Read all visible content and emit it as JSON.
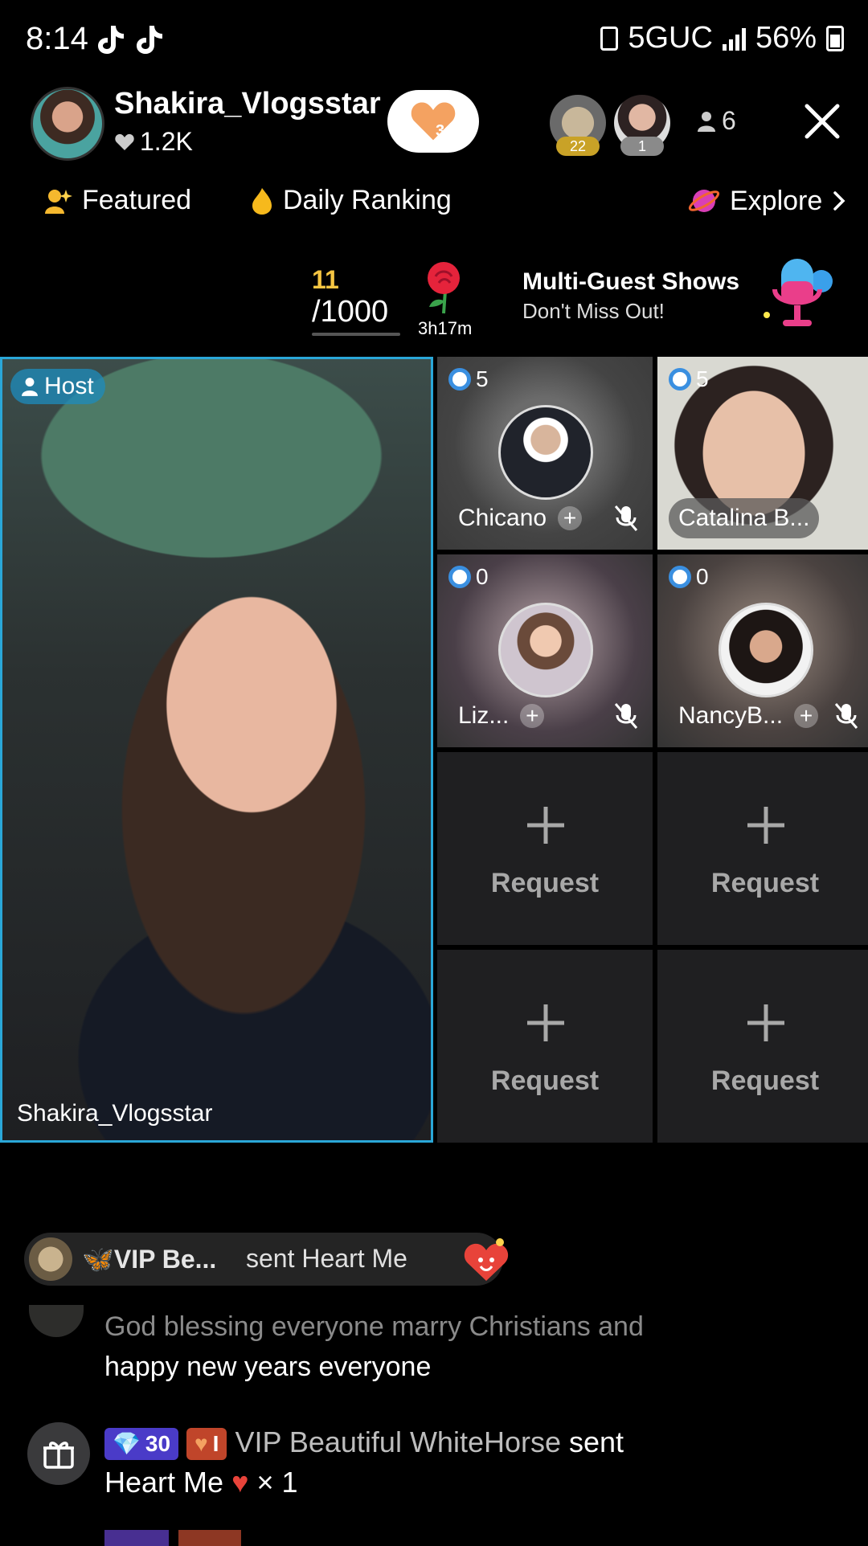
{
  "status_bar": {
    "time": "8:14",
    "network": "5GUC",
    "battery": "56%"
  },
  "header": {
    "host_name": "Shakira_Vlogsstar",
    "likes": "1.2K",
    "follow_level": "3",
    "viewers": [
      {
        "badge": "22",
        "badge_color": "#c9a227"
      },
      {
        "badge": "1",
        "badge_color": "#8a8a8a"
      }
    ],
    "viewer_count": "6"
  },
  "nav": {
    "featured": "Featured",
    "daily_ranking": "Daily Ranking",
    "explore": "Explore"
  },
  "promo": {
    "goal_current": "11",
    "goal_total": "/1000",
    "rose_timer": "3h17m",
    "multi_title": "Multi-Guest Shows",
    "multi_subtitle": "Don't Miss Out!"
  },
  "host_tile": {
    "label": "Host",
    "name": "Shakira_Vlogsstar",
    "accent": "#2aa7d8"
  },
  "guests": [
    {
      "score": "5",
      "name": "Chicano"
    },
    {
      "score": "5",
      "name": "Catalina B..."
    },
    {
      "score": "0",
      "name": "Liz..."
    },
    {
      "score": "0",
      "name": "NancyB..."
    }
  ],
  "request_label": "Request",
  "chat": {
    "gift_pill": {
      "who": "VIP Be...",
      "action": "sent Heart Me"
    },
    "message1_faded": "God blessing everyone marry Christians and",
    "message1": "happy new years everyone",
    "message2": {
      "level1": "30",
      "level2": "I",
      "user": "VIP Beautiful WhiteHorse",
      "action": "sent",
      "gift": "Heart Me",
      "count": "× 1"
    }
  }
}
